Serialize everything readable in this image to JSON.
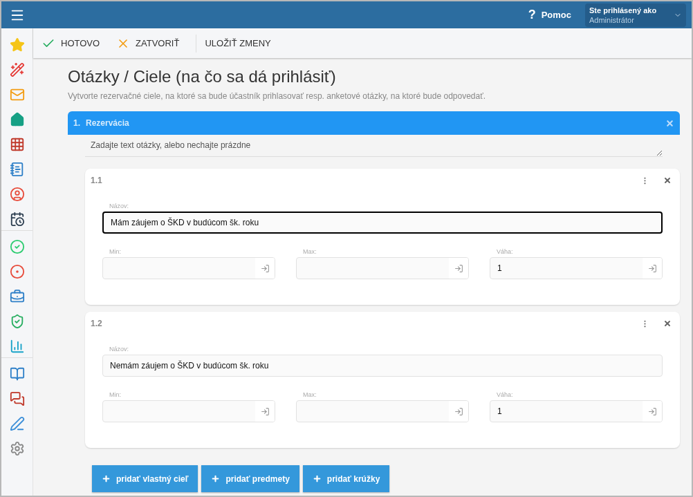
{
  "topbar": {
    "help_icon": "?",
    "help": "Pomoc",
    "user_label": "Ste prihlásený ako",
    "user_name": "Administrátor"
  },
  "toolbar": [
    {
      "kind": "done",
      "label": "HOTOVO"
    },
    {
      "kind": "close",
      "label": "ZATVORIŤ"
    },
    {
      "kind": "save",
      "label": "ULOŽIŤ ZMENY"
    }
  ],
  "page": {
    "title": "Otázky / Ciele (na čo sa dá prihlásiť)",
    "subtitle": "Vytvorte rezervačné ciele, na ktoré sa bude účastník prihlasovať resp. anketové otázky, na ktoré bude odpovedať."
  },
  "question": {
    "number": "1.",
    "title": "Rezervácia",
    "text_placeholder": "Zadajte text otázky, alebo nechajte prázdne",
    "answers": [
      {
        "number": "1.1",
        "name_label": "Názov:",
        "name": "Mám záujem o ŠKD v budúcom šk. roku",
        "focused": true,
        "fields": [
          {
            "label": "Min:"
          },
          {
            "label": "Max:"
          },
          {
            "label": "Váha:",
            "value": "1"
          }
        ]
      },
      {
        "number": "1.2",
        "name_label": "Názov:",
        "name": "Nemám záujem o ŠKD v budúcom šk. roku",
        "focused": false,
        "fields": [
          {
            "label": "Min:"
          },
          {
            "label": "Max:"
          },
          {
            "label": "Váha:",
            "value": "1"
          }
        ]
      }
    ]
  },
  "buttons": [
    "pridať vlastný cieľ",
    "pridať predmety",
    "pridať krúžky"
  ]
}
